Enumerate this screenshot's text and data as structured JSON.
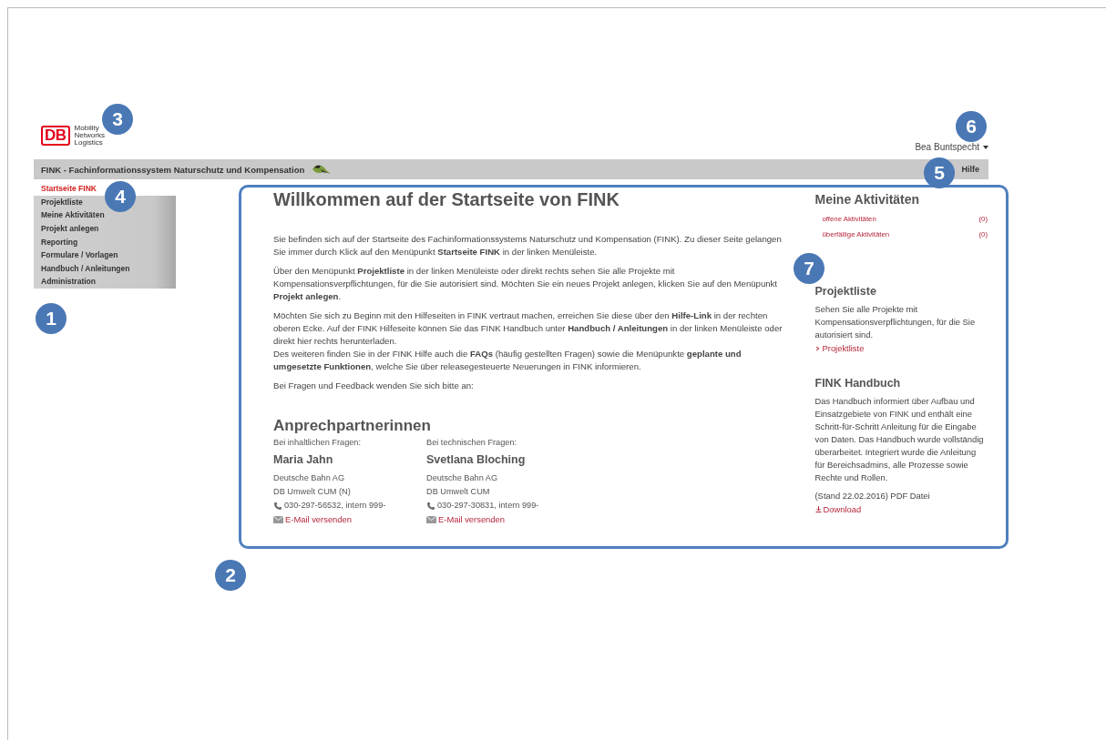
{
  "logo": {
    "mark": "DB",
    "lines": [
      "Mobility",
      "Networks",
      "Logistics"
    ]
  },
  "user": {
    "name": "Bea Buntspecht"
  },
  "header": {
    "title": "FINK - Fachinformationssystem Naturschutz und Kompensation",
    "help": "Hilfe"
  },
  "menu": [
    {
      "label": "Startseite FINK",
      "selected": true
    },
    {
      "label": "Projektliste",
      "selected": false
    },
    {
      "label": "Meine Aktivitäten",
      "selected": false
    },
    {
      "label": "Projekt anlegen",
      "selected": false
    },
    {
      "label": "Reporting",
      "selected": false
    },
    {
      "label": "Formulare / Vorlagen",
      "selected": false
    },
    {
      "label": "Handbuch / Anleitungen",
      "selected": false
    },
    {
      "label": "Administration",
      "selected": false
    }
  ],
  "main": {
    "title": "Willkommen auf der Startseite von FINK",
    "paragraphs": [
      {
        "lines": [
          "Sie befinden sich auf der Startseite des Fachinformationssystems Naturschutz und Kompensation (FINK). Zu dieser Seite gelangen Sie immer durch Klick auf den Menüpunkt **Startseite FINK** in der linken Menüleiste."
        ]
      },
      {
        "lines": [
          "Über den Menüpunkt **Projektliste** in der linken Menüleiste oder direkt rechts sehen Sie alle Projekte mit Kompensationsverpflichtungen, für die Sie autorisiert sind. Möchten Sie ein neues Projekt anlegen, klicken Sie auf den Menüpunkt **Projekt anlegen**."
        ]
      },
      {
        "lines": [
          "Möchten Sie sich zu Beginn mit den Hilfeseiten in FINK vertraut machen, erreichen Sie diese über den **Hilfe-Link** in der rechten oberen Ecke. Auf der FINK Hilfeseite können Sie das FINK Handbuch unter **Handbuch / Anleitungen** in der linken Menüleiste oder direkt hier rechts herunterladen.",
          "Des weiteren finden Sie in der FINK Hilfe auch die **FAQs** (häufig gestellten Fragen) sowie die Menüpunkte **geplante und umgesetzte Funktionen**, welche Sie über releasegesteuerte Neuerungen in FINK informieren."
        ]
      },
      {
        "lines": [
          "Bei Fragen und Feedback wenden Sie sich bitte an:"
        ]
      }
    ],
    "contacts_title": "Anprechpartnerinnen",
    "contacts": [
      {
        "label": "Bei inhaltlichen Fragen:",
        "name": "Maria Jahn",
        "company": "Deutsche Bahn AG",
        "department": "DB Umwelt CUM (N)",
        "phone": "030-297-56532, intern 999-",
        "email": "E-Mail versenden"
      },
      {
        "label": "Bei technischen Fragen:",
        "name": "Svetlana Bloching",
        "company": "Deutsche Bahn AG",
        "department": "DB Umwelt CUM",
        "phone": "030-297-30831, intern 999-",
        "email": "E-Mail versenden"
      }
    ]
  },
  "sidebar": {
    "activities": {
      "title": "Meine Aktivitäten",
      "items": [
        {
          "label": "offene Aktivitäten",
          "count": "(0)"
        },
        {
          "label": "überfällige Aktivitäten",
          "count": "(0)"
        }
      ]
    },
    "projects": {
      "title": "Projektliste",
      "text": "Sehen Sie alle Projekte mit Kompensationsverpflichtungen, für die Sie autorisiert sind.",
      "link": "Projektliste"
    },
    "handbook": {
      "title": "FINK Handbuch",
      "text": "Das Handbuch informiert über Aufbau und Einsatzgebiete von FINK und enthält eine Schritt-für-Schritt Anleitung für die Eingabe von Daten. Das Handbuch wurde vollständig überarbeitet. Integriert wurde die Anleitung für Bereichsadmins, alle Prozesse sowie Rechte und Rollen.",
      "stand": "(Stand 22.02.2016) PDF Datei",
      "link": "Download"
    }
  },
  "callouts": [
    {
      "number": "1"
    },
    {
      "number": "2"
    },
    {
      "number": "3"
    },
    {
      "number": "4"
    },
    {
      "number": "5"
    },
    {
      "number": "6"
    },
    {
      "number": "7"
    }
  ]
}
